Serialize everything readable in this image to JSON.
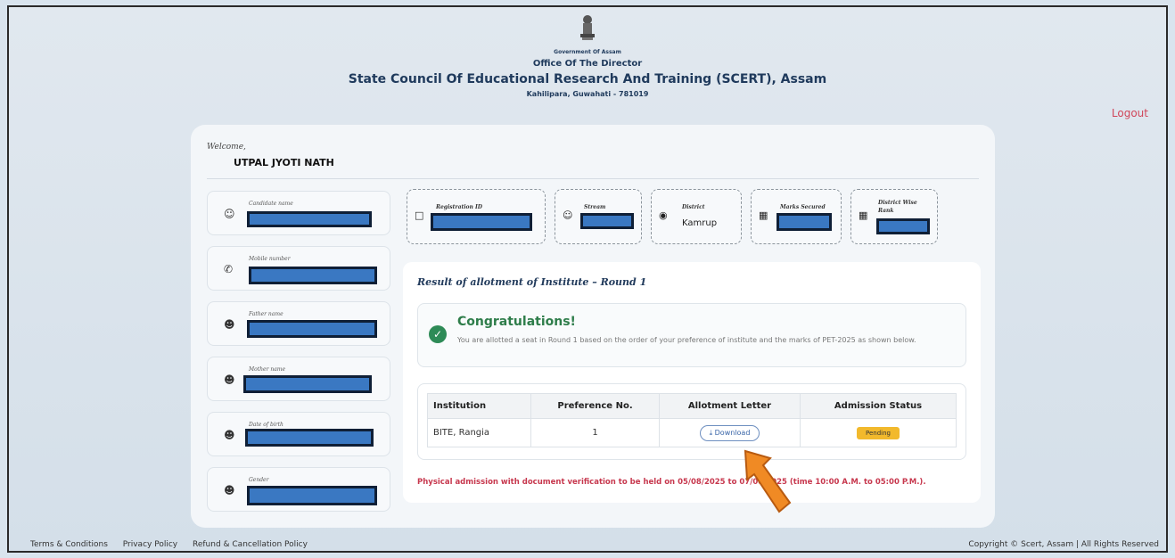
{
  "header": {
    "gov": "Government Of Assam",
    "office": "Office Of The Director",
    "council": "State Council Of Educational Research And Training (SCERT), Assam",
    "address": "Kahilipara, Guwahati - 781019"
  },
  "logout_label": "Logout",
  "welcome": "Welcome,",
  "username": "UTPAL JYOTI NATH",
  "profile": [
    {
      "label": "Candidate name",
      "icon": "user-icon"
    },
    {
      "label": "Mobile number",
      "icon": "phone-icon"
    },
    {
      "label": "Father name",
      "icon": "id-card-icon"
    },
    {
      "label": "Mother name",
      "icon": "id-card-icon"
    },
    {
      "label": "Date of birth",
      "icon": "id-card-icon"
    },
    {
      "label": "Gender",
      "icon": "id-card-icon"
    }
  ],
  "stats": {
    "registration_label": "Registration ID",
    "stream_label": "Stream",
    "district_label": "District",
    "district_value": "Kamrup",
    "marks_label": "Marks Secured",
    "rank_label": "District Wise Rank"
  },
  "result": {
    "title": "Result of allotment of Institute – Round 1",
    "congrats_title": "Congratulations!",
    "congrats_msg": "You are allotted a seat in Round 1 based on the order of your preference of institute and the marks of PET-2025 as shown below.",
    "columns": [
      "Institution",
      "Preference No.",
      "Allotment Letter",
      "Admission Status"
    ],
    "row": {
      "institution": "BITE, Rangia",
      "preference": "1",
      "download": "⤓ Download",
      "status": "Pending"
    },
    "notice": "Physical admission with document verification to be held on 05/08/2025 to 07/08/2025 (time 10:00 A.M. to 05:00 P.M.)."
  },
  "footer": {
    "terms": "Terms & Conditions",
    "privacy": "Privacy Policy",
    "refund": "Refund & Cancellation Policy",
    "copyright": "Copyright © Scert, Assam | All Rights Reserved"
  },
  "colors": {
    "accent_red": "#c7384e",
    "success": "#2e8b57",
    "pending": "#f2b92c",
    "title_blue": "#1f3a5c"
  }
}
